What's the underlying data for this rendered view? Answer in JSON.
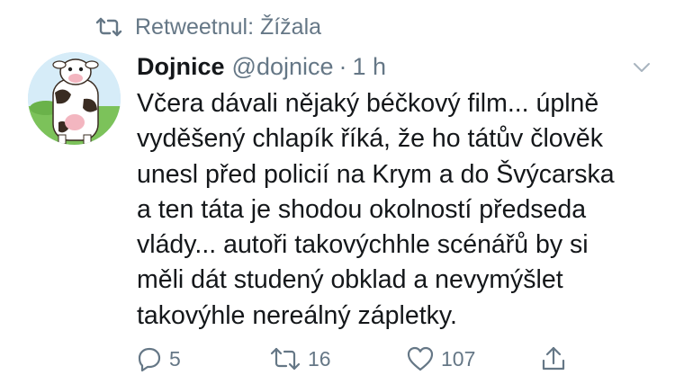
{
  "retweet": {
    "label": "Retweetnul: Žížala",
    "icon": "retweet-icon"
  },
  "tweet": {
    "display_name": "Dojnice",
    "handle": "@dojnice",
    "separator": "·",
    "time": "1 h",
    "text": "Včera dávali nějaký béčkový film... úplně\nvyděšený chlapík říká, že ho tátův člověk\nunesl před policií na Krym a do Švýcarska\na ten táta je shodou okolností předseda\nvlády... autoři takovýchhle scénářů by si\nměli dát studený obklad a nevymýšlet\ntakovýhle nereálný zápletky.",
    "avatar_icon": "cow-avatar"
  },
  "actions": {
    "reply": {
      "icon": "reply-icon",
      "count": "5"
    },
    "retweet": {
      "icon": "retweet-icon",
      "count": "16"
    },
    "like": {
      "icon": "heart-icon",
      "count": "107"
    },
    "share": {
      "icon": "share-icon"
    }
  },
  "colors": {
    "text": "#14171a",
    "secondary": "#657786",
    "background": "#ffffff"
  }
}
